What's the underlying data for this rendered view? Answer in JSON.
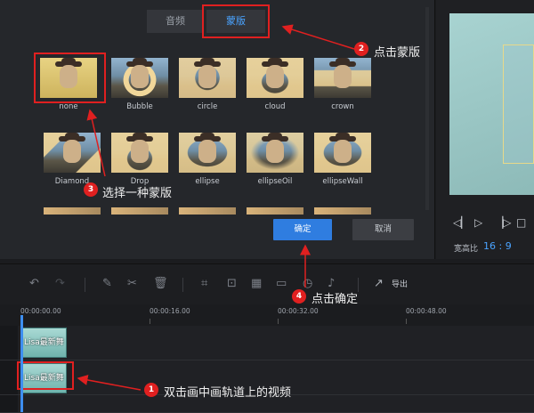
{
  "dialog": {
    "tabs": [
      {
        "label": "音频"
      },
      {
        "label": "蒙版"
      }
    ],
    "masks": [
      {
        "label": "none"
      },
      {
        "label": "Bubble"
      },
      {
        "label": "circle"
      },
      {
        "label": "cloud"
      },
      {
        "label": "crown"
      },
      {
        "label": "Diamond"
      },
      {
        "label": "Drop"
      },
      {
        "label": "ellipse"
      },
      {
        "label": "ellipseOil"
      },
      {
        "label": "ellipseWall"
      }
    ],
    "ok_label": "确定",
    "cancel_label": "取消"
  },
  "preview": {
    "ratio_label": "宽高比",
    "ratio_value": "16 : 9"
  },
  "toolbar": {
    "export_label": "导出"
  },
  "timeline": {
    "timecodes": [
      "00:00:00.00",
      "00:00:16.00",
      "00:00:32.00",
      "00:00:48.00"
    ],
    "clips": [
      {
        "text": "Lisa最新舞"
      },
      {
        "text": "Lisa最新舞"
      }
    ]
  },
  "annotations": [
    {
      "number": "1",
      "text": "双击画中画轨道上的视频"
    },
    {
      "number": "2",
      "text": "点击蒙版"
    },
    {
      "number": "3",
      "text": "选择一种蒙版"
    },
    {
      "number": "4",
      "text": "点击确定"
    }
  ],
  "colors": {
    "accent": "#2f7de0",
    "highlight": "#e02020",
    "tab_active_text": "#4aa3ff"
  }
}
